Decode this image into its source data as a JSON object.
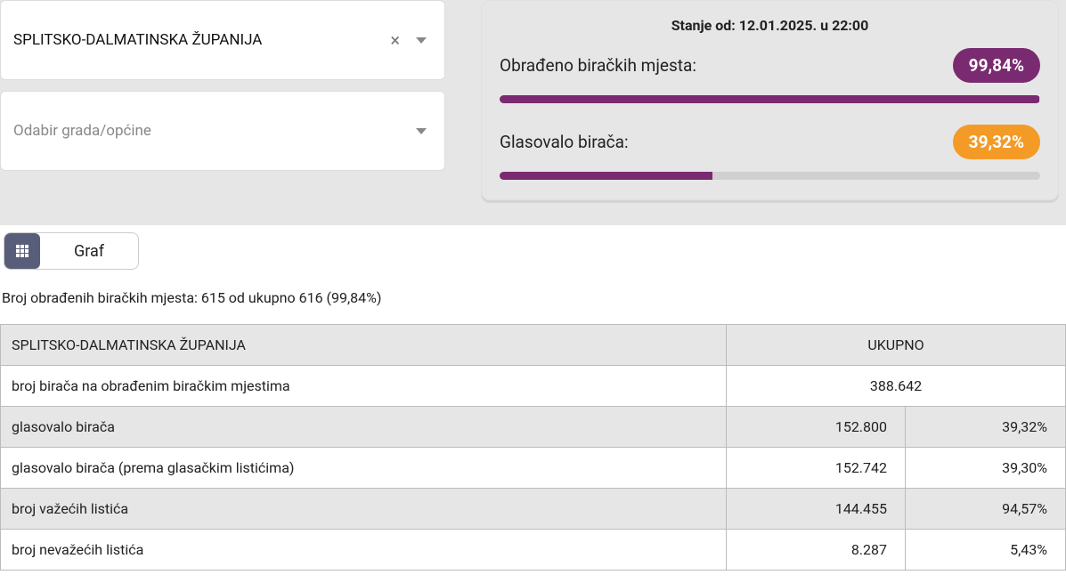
{
  "selects": {
    "county_value": "SPLITSKO-DALMATINSKA ŽUPANIJA",
    "city_placeholder": "Odabir grada/općine"
  },
  "status": {
    "title": "Stanje od: 12.01.2025. u 22:00",
    "processed_label": "Obrađeno biračkih mjesta:",
    "processed_pct": "99,84%",
    "processed_fill": 99.84,
    "voted_label": "Glasovalo birača:",
    "voted_pct": "39,32%",
    "voted_fill": 39.32
  },
  "toggle": {
    "graf_label": "Graf"
  },
  "summary": "Broj obrađenih biračkih mjesta: 615 od ukupno 616 (99,84%)",
  "table": {
    "header_left": "SPLITSKO-DALMATINSKA ŽUPANIJA",
    "header_right": "UKUPNO",
    "rows": [
      {
        "label": "broj birača na obrađenim biračkim mjestima",
        "value": "388.642",
        "pct": null
      },
      {
        "label": "glasovalo birača",
        "value": "152.800",
        "pct": "39,32%"
      },
      {
        "label": "glasovalo birača (prema glasačkim listićima)",
        "value": "152.742",
        "pct": "39,30%"
      },
      {
        "label": "broj važećih listića",
        "value": "144.455",
        "pct": "94,57%"
      },
      {
        "label": "broj nevažećih listića",
        "value": "8.287",
        "pct": "5,43%"
      }
    ]
  }
}
